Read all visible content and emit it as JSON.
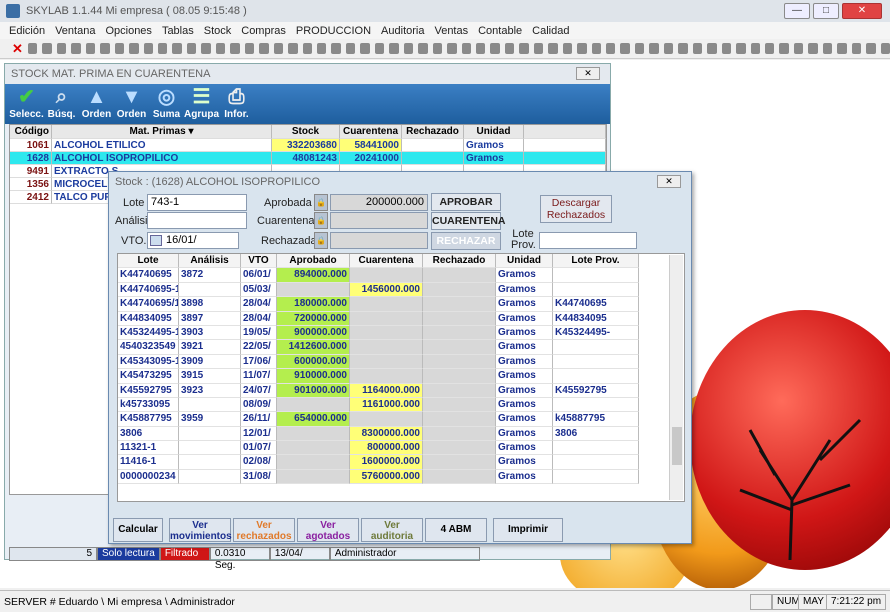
{
  "app": {
    "title": "SKYLAB 1.1.44   Mi empresa  ( 08.05          9:15:48 )",
    "min": "—",
    "max": "□",
    "close": "✕"
  },
  "menu": [
    "Edición",
    "Ventana",
    "Opciones",
    "Tablas",
    "Stock",
    "Compras",
    "PRODUCCION",
    "Auditoria",
    "Ventas",
    "Contable",
    "Calidad"
  ],
  "outer": {
    "title": "STOCK MAT. PRIMA EN CUARENTENA",
    "close": "✕",
    "toolbar": [
      "Selecc.",
      "Búsq.",
      "Orden",
      "Orden",
      "Suma",
      "Agrupa",
      "Infor."
    ],
    "headers": [
      "Código",
      "Mat. Primas ▾",
      "Stock",
      "Cuarentena",
      "Rechazado",
      "Unidad"
    ],
    "rows": [
      [
        "1061",
        "ALCOHOL ETILICO",
        "332203680",
        "58441000",
        "",
        "Gramos"
      ],
      [
        "1628",
        "ALCOHOL ISOPROPILICO",
        "48081243",
        "20241000",
        "",
        "Gramos"
      ],
      [
        "9491",
        "EXTRACTO S",
        "",
        "",
        "",
        ""
      ],
      [
        "1356",
        "MICROCEL C",
        "",
        "",
        "",
        ""
      ],
      [
        "2412",
        "TALCO PURO",
        "",
        "",
        "",
        ""
      ]
    ],
    "status": {
      "count": "5",
      "mode": "Solo lectura",
      "filter": "Filtrado",
      "time": "0.0310 Seg.",
      "date": "13/04/",
      "user": "Administrador"
    }
  },
  "dialog": {
    "title": "Stock :  (1628)  ALCOHOL ISOPROPILICO",
    "close": "✕",
    "lote_label": "Lote",
    "lote_value": "743-1",
    "analisis_label": "Análisis",
    "analisis_value": "",
    "vto_label": "VTO.",
    "vto_value": "16/01/",
    "aprobada_label": "Aprobada",
    "aprobada_value": "200000.000",
    "cuarentena_label": "Cuarentena",
    "cuarentena_value": "",
    "rechazada_label": "Rechazada",
    "rechazada_value": "",
    "btn_aprobar": "APROBAR",
    "btn_cuarentena": "CUARENTENA",
    "btn_rechazar": "RECHAZAR",
    "btn_descargar": "Descargar Rechazados",
    "lote_prov_label": "Lote Prov.",
    "headers": [
      "Lote",
      "Análisis",
      "VTO",
      "Aprobado",
      "Cuarentena",
      "Rechazado",
      "Unidad",
      "Lote Prov."
    ],
    "rows": [
      [
        "K44740695",
        "3872",
        "06/01/",
        "894000.000",
        "",
        "",
        "Gramos",
        ""
      ],
      [
        "K44740695-1",
        "",
        "05/03/",
        "",
        "1456000.000",
        "",
        "Gramos",
        ""
      ],
      [
        "K44740695/1",
        "3898",
        "28/04/",
        "180000.000",
        "",
        "",
        "Gramos",
        "K44740695"
      ],
      [
        "K44834095",
        "3897",
        "28/04/",
        "720000.000",
        "",
        "",
        "Gramos",
        "K44834095"
      ],
      [
        "K45324495-1",
        "3903",
        "19/05/",
        "900000.000",
        "",
        "",
        "Gramos",
        "K45324495-"
      ],
      [
        "4540323549",
        "3921",
        "22/05/",
        "1412600.000",
        "",
        "",
        "Gramos",
        ""
      ],
      [
        "K45343095-1",
        "3909",
        "17/06/",
        "600000.000",
        "",
        "",
        "Gramos",
        ""
      ],
      [
        "K45473295",
        "3915",
        "11/07/",
        "910000.000",
        "",
        "",
        "Gramos",
        ""
      ],
      [
        "K45592795",
        "3923",
        "24/07/",
        "901000.000",
        "1164000.000",
        "",
        "Gramos",
        "K45592795"
      ],
      [
        "k45733095",
        "",
        "08/09/",
        "",
        "1161000.000",
        "",
        "Gramos",
        ""
      ],
      [
        "K45887795",
        "3959",
        "26/11/",
        "654000.000",
        "",
        "",
        "Gramos",
        "k45887795"
      ],
      [
        "3806",
        "",
        "12/01/",
        "",
        "8300000.000",
        "",
        "Gramos",
        "3806"
      ],
      [
        "11321-1",
        "",
        "01/07/",
        "",
        "800000.000",
        "",
        "Gramos",
        ""
      ],
      [
        "11416-1",
        "",
        "02/08/",
        "",
        "1600000.000",
        "",
        "Gramos",
        ""
      ],
      [
        "0000000234",
        "",
        "31/08/",
        "",
        "5760000.000",
        "",
        "Gramos",
        ""
      ]
    ],
    "bottom": [
      "Calcular",
      "Ver movimientos",
      "Ver rechazados",
      "Ver agotados",
      "Ver auditoria",
      "4 ABM",
      "Imprimir"
    ]
  },
  "statusbar": {
    "path": "SERVER # Eduardo \\ Mi empresa \\ Administrador",
    "num": "NUM",
    "may": "MAY",
    "time": "7:21:22 pm"
  },
  "colors": {
    "selected": "#2ee8ee",
    "approved": "#ffff77",
    "status_blue": "#1b3b9e",
    "status_red": "#d01616"
  }
}
